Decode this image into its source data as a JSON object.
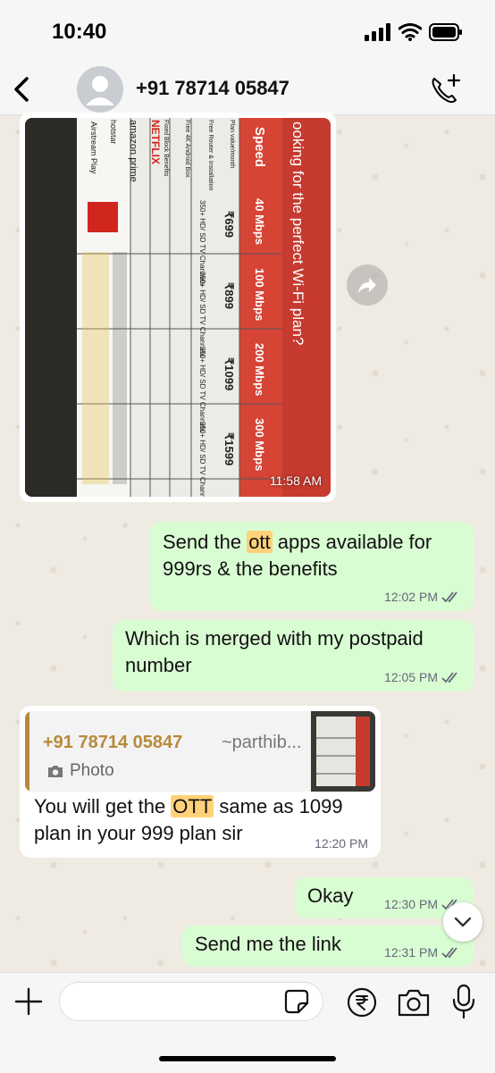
{
  "status_bar": {
    "time": "10:40"
  },
  "header": {
    "contact": "+91 78714 05847"
  },
  "image_message": {
    "time": "11:58 AM",
    "photo_text": {
      "heading": "ooking for the perfect Wi-Fi plan?",
      "speed_label": "Speed",
      "speeds": [
        "40 Mbps",
        "100 Mbps",
        "200 Mbps",
        "300 Mbps"
      ],
      "prices": [
        "₹699",
        "₹899",
        "₹1099",
        "₹1599"
      ],
      "channels": "350+ HD/ SD TV Channels",
      "rows": [
        "Plan value/month",
        "Free Router & Installation",
        "Free 4K Android Box",
        "Fixed Block Benefits"
      ],
      "brands": [
        "NETFLIX",
        "amazon prime",
        "hotstar",
        "Airstream Play"
      ]
    }
  },
  "messages": [
    {
      "parts": [
        "Send the ",
        "ott",
        " apps available for 999rs & the benefits"
      ],
      "time": "12:02 PM"
    },
    {
      "text": "Which is merged with my postpaid number",
      "time": "12:05 PM"
    },
    {
      "quote_name": "+91 78714 05847",
      "quote_handle": "~parthib...",
      "quote_type": "Photo",
      "parts": [
        "You will get the ",
        "OTT",
        " same as 1099 plan in your 999 plan sir"
      ],
      "time": "12:20 PM"
    },
    {
      "text": "Okay",
      "time": "12:30 PM"
    },
    {
      "text": "Send me the link",
      "time": "12:31 PM"
    }
  ],
  "input": {
    "placeholder": ""
  },
  "colors": {
    "outgoing": "#d9fdd3",
    "incoming": "#ffffff",
    "highlight": "#ffd279",
    "quote_accent": "#b88a3a"
  }
}
